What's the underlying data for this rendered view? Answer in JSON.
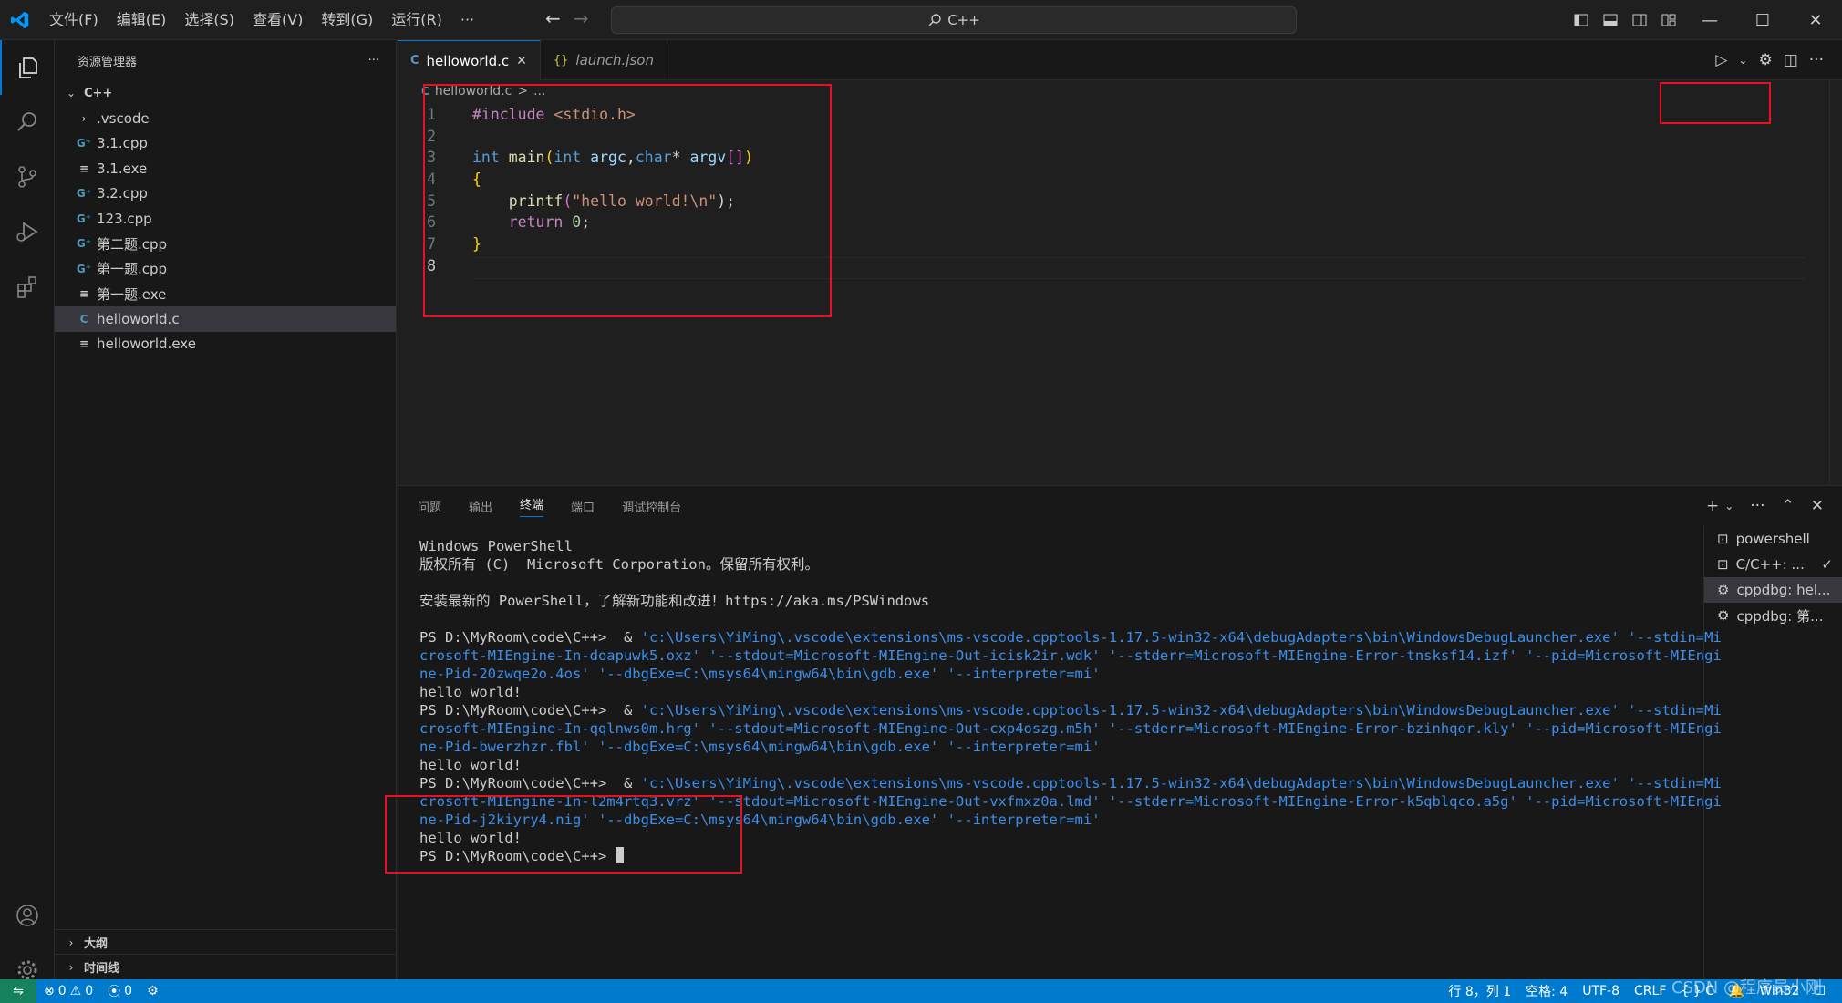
{
  "menu": [
    "文件(F)",
    "编辑(E)",
    "选择(S)",
    "查看(V)",
    "转到(G)",
    "运行(R)",
    "···"
  ],
  "command_center": "C++",
  "explorer": {
    "title": "资源管理器",
    "root": "C++",
    "items": [
      {
        "label": ".vscode",
        "icon": "chevron-right-icon"
      },
      {
        "label": "3.1.cpp",
        "icon": "cpp-file-icon"
      },
      {
        "label": "3.1.exe",
        "icon": "exe-file-icon"
      },
      {
        "label": "3.2.cpp",
        "icon": "cpp-file-icon"
      },
      {
        "label": "123.cpp",
        "icon": "cpp-file-icon"
      },
      {
        "label": "第二题.cpp",
        "icon": "cpp-file-icon"
      },
      {
        "label": "第一题.cpp",
        "icon": "cpp-file-icon"
      },
      {
        "label": "第一题.exe",
        "icon": "exe-file-icon"
      },
      {
        "label": "helloworld.c",
        "icon": "c-file-icon"
      },
      {
        "label": "helloworld.exe",
        "icon": "exe-file-icon"
      }
    ],
    "outline": "大纲",
    "timeline": "时间线"
  },
  "tabs": [
    {
      "label": "helloworld.c",
      "badge": "C",
      "active": true
    },
    {
      "label": "launch.json",
      "badge": "{}",
      "active": false
    }
  ],
  "breadcrumb": {
    "file": "helloworld.c",
    "sep": ">",
    "rest": "..."
  },
  "code_lines": [
    "1",
    "2",
    "3",
    "4",
    "5",
    "6",
    "7",
    "8"
  ],
  "code": {
    "l1_inc": "#include",
    "l1_hdr": " <stdio.h>",
    "l3_int": "int",
    "l3_main": " main",
    "l3_p1": "(",
    "l3_int2": "int",
    "l3_argc": " argc",
    "l3_comma": ",",
    "l3_char": "char",
    "l3_star": "* ",
    "l3_argv": "argv",
    "l3_br": "[]",
    "l3_p2": ")",
    "l4": "{",
    "l5_fn": "printf",
    "l5_p1": "(",
    "l5_str": "\"hello world!\\n\"",
    "l5_p2": ");",
    "l6_ret": "return",
    "l6_num": " 0",
    "l6_semi": ";",
    "l7": "}"
  },
  "panel_tabs": [
    "问题",
    "输出",
    "终端",
    "端口",
    "调试控制台"
  ],
  "terminal": {
    "l1": "Windows PowerShell",
    "l2": "版权所有 (C)  Microsoft Corporation。保留所有权利。",
    "l3": "安装最新的 PowerShell，了解新功能和改进！https://aka.ms/PSWindows",
    "prompt": "PS D:\\MyRoom\\code\\C++>  & ",
    "run1_a": "'c:\\Users\\YiMing\\.vscode\\extensions\\ms-vscode.cpptools-1.17.5-win32-x64\\debugAdapters\\bin\\WindowsDebugLauncher.exe' '--stdin=Mi",
    "run1_b": "crosoft-MIEngine-In-doapuwk5.oxz' '--stdout=Microsoft-MIEngine-Out-icisk2ir.wdk' '--stderr=Microsoft-MIEngine-Error-tnsksf14.izf' '--pid=Microsoft-MIEngi",
    "run1_c": "ne-Pid-20zwqe2o.4os' '--dbgExe=C:\\msys64\\mingw64\\bin\\gdb.exe' '--interpreter=mi'",
    "run2_a": "'c:\\Users\\YiMing\\.vscode\\extensions\\ms-vscode.cpptools-1.17.5-win32-x64\\debugAdapters\\bin\\WindowsDebugLauncher.exe' '--stdin=Mi",
    "run2_b": "crosoft-MIEngine-In-qqlnws0m.hrg' '--stdout=Microsoft-MIEngine-Out-cxp4oszg.m5h' '--stderr=Microsoft-MIEngine-Error-bzinhqor.kly' '--pid=Microsoft-MIEngi",
    "run2_c": "ne-Pid-bwerzhzr.fbl' '--dbgExe=C:\\msys64\\mingw64\\bin\\gdb.exe' '--interpreter=mi'",
    "run3_a": "'c:\\Users\\YiMing\\.vscode\\extensions\\ms-vscode.cpptools-1.17.5-win32-x64\\debugAdapters\\bin\\WindowsDebugLauncher.exe' '--stdin=Mi",
    "run3_b": "crosoft-MIEngine-In-l2m4rtq3.vrz' '--stdout=Microsoft-MIEngine-Out-vxfmxz0a.lmd' '--stderr=Microsoft-MIEngine-Error-k5qblqco.a5g' '--pid=Microsoft-MIEngi",
    "run3_c": "ne-Pid-j2kiyry4.nig' '--dbgExe=C:\\msys64\\mingw64\\bin\\gdb.exe' '--interpreter=mi'",
    "output": "hello world!",
    "final_prompt": "PS D:\\MyRoom\\code\\C++> "
  },
  "terminal_list": [
    {
      "label": "powershell",
      "icon": "terminal-icon"
    },
    {
      "label": "C/C++: ...",
      "icon": "terminal-icon"
    },
    {
      "label": "cppdbg: hel...",
      "icon": "debug-gear-icon"
    },
    {
      "label": "cppdbg: 第...",
      "icon": "debug-gear-icon"
    }
  ],
  "status": {
    "errors": "0",
    "warnings": "0",
    "ports": "0",
    "position": "行 8，列 1",
    "spaces": "空格: 4",
    "encoding": "UTF-8",
    "eol": "CRLF",
    "lang": "{ } C",
    "platform": "Win32"
  },
  "watermark": "CSDN @程序员小刚",
  "colors": {
    "accent": "#007acc",
    "annotation": "#e81123"
  }
}
